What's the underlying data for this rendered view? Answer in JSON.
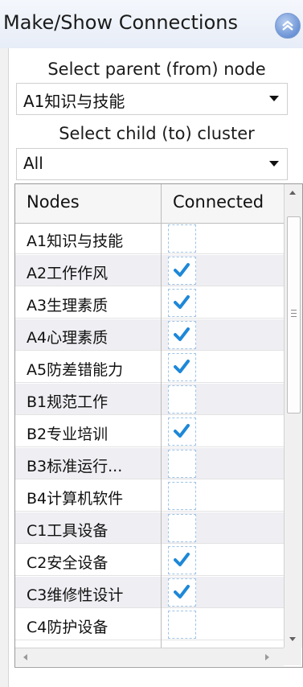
{
  "panel": {
    "title": "Make/Show Connections",
    "collapse_icon": "chevron-double-up-icon"
  },
  "parent": {
    "label": "Select parent (from) node",
    "value": "A1知识与技能"
  },
  "child": {
    "label": "Select child (to) cluster",
    "value": "All"
  },
  "grid": {
    "columns": [
      "Nodes",
      "Connected"
    ],
    "rows": [
      {
        "node": "A1知识与技能",
        "connected": false
      },
      {
        "node": "A2工作作风",
        "connected": true
      },
      {
        "node": "A3生理素质",
        "connected": true
      },
      {
        "node": "A4心理素质",
        "connected": true
      },
      {
        "node": "A5防差错能力",
        "connected": true
      },
      {
        "node": "B1规范工作",
        "connected": false
      },
      {
        "node": "B2专业培训",
        "connected": true
      },
      {
        "node": "B3标准运行...",
        "connected": false
      },
      {
        "node": "B4计算机软件",
        "connected": false
      },
      {
        "node": "C1工具设备",
        "connected": false
      },
      {
        "node": "C2安全设备",
        "connected": true
      },
      {
        "node": "C3维修性设计",
        "connected": true
      },
      {
        "node": "C4防护设备",
        "connected": false
      }
    ],
    "check_color": "#1e88d8"
  }
}
